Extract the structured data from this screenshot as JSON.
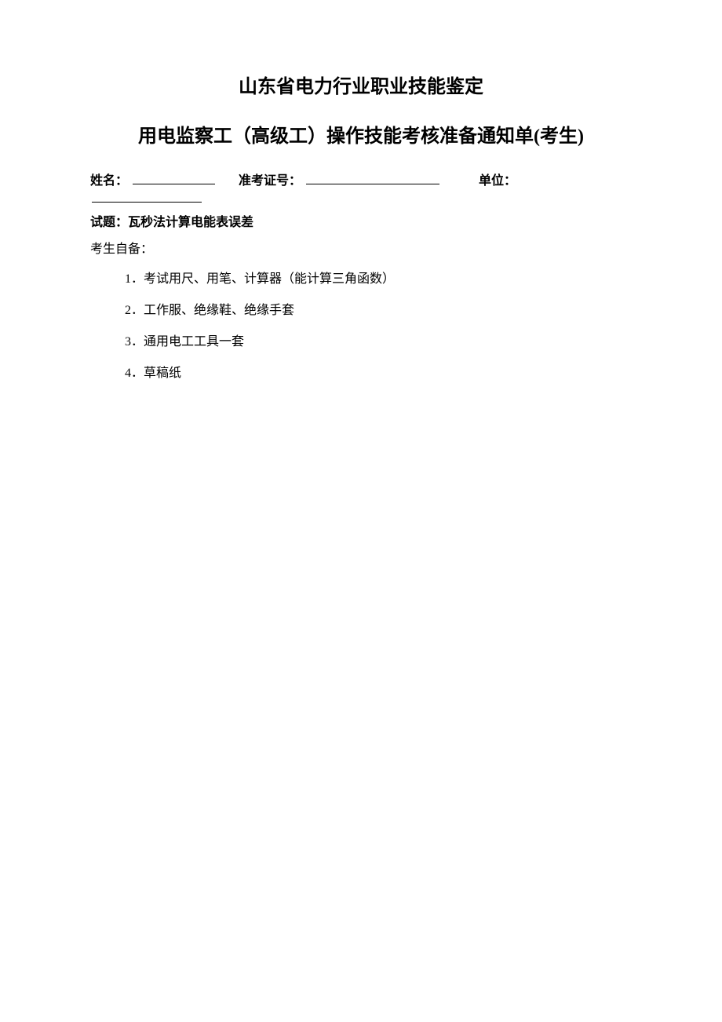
{
  "title1": "山东省电力行业职业技能鉴定",
  "title2": "用电监察工（高级工）操作技能考核准备通知单(考生)",
  "info": {
    "name_label": "姓名：",
    "id_label": "准考证号：",
    "unit_label": "单位："
  },
  "topic": {
    "label": "试题：",
    "value": "瓦秒法计算电能表误差"
  },
  "section_label": "考生自备：",
  "items": [
    "1．考试用尺、用笔、计算器（能计算三角函数）",
    "2．工作服、绝缘鞋、绝缘手套",
    "3．通用电工工具一套",
    "4．草稿纸"
  ]
}
